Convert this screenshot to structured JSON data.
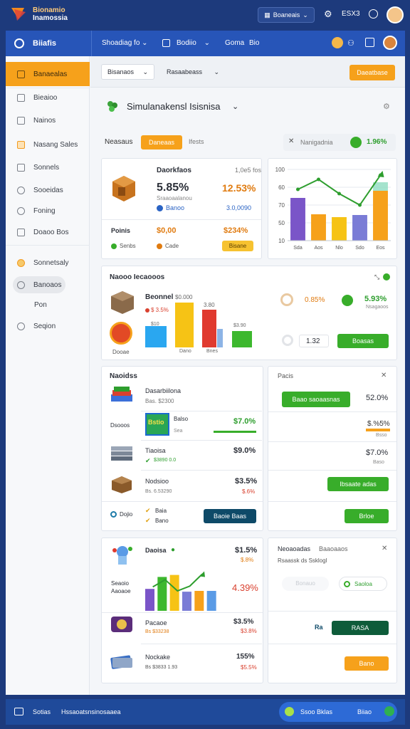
{
  "app": {
    "title_line1": "Bionamio",
    "title_line2": "Inamossia"
  },
  "topbar": {
    "selector_label": "Boaneais",
    "code_label": "ESX3"
  },
  "navbar": {
    "brand": "Biiafis",
    "menu1": "Shoadiag fo",
    "menu2": "Bodiio",
    "menu3": "Goma",
    "menu4": "Bio"
  },
  "sidebar": {
    "items": [
      {
        "label": "Banaealas"
      },
      {
        "label": "Bieaioo"
      },
      {
        "label": "Nainos"
      },
      {
        "label": "Nasang Sales"
      },
      {
        "label": "Sonnels"
      },
      {
        "label": "Sooeidas"
      },
      {
        "label": "Foning"
      },
      {
        "label": "Doaoo Bos"
      },
      {
        "label": "Sonnetsaly"
      },
      {
        "label": "Banoaos"
      },
      {
        "label": "Pon"
      },
      {
        "label": "Seqion"
      }
    ]
  },
  "filters": {
    "dropdown1": "Bisanaos",
    "dropdown2": "Rasaabeass",
    "action": "Daeatbase"
  },
  "page": {
    "title": "Simulanakensl Isisnisa"
  },
  "tabs": {
    "label": "Neasaus",
    "active": "Daneaas",
    "other": "Ifests"
  },
  "search": {
    "placeholder": "Nanigadnia",
    "value": "1.96%"
  },
  "kpi": {
    "heading": "Daorkfaos",
    "heading_right": "1,0e5 fos",
    "main_value": "5.85%",
    "main_change": "12.53%",
    "sub_label": "Sraaoaalanou",
    "sub_link": "Banoo",
    "sub_right": "3.0,0090",
    "row2_label": "Poinis",
    "row2_value": "$0,00",
    "row2_right": "$234%",
    "row3_a": "Senbs",
    "row3_b": "Cade",
    "button": "Bisane"
  },
  "chart1": {
    "yticks": [
      "100",
      "60",
      "70",
      "50",
      "10"
    ],
    "xlabels": [
      "Sda",
      "Aos",
      "Nlo",
      "Sdo",
      "Eos"
    ]
  },
  "chart_data": {
    "type": "bar",
    "categories": [
      "Sda",
      "Aos",
      "Nlo",
      "Sdo",
      "Eos"
    ],
    "values": [
      60,
      37,
      33,
      36,
      70
    ],
    "line": [
      72,
      86,
      66,
      50,
      92
    ],
    "ylim": [
      0,
      100
    ],
    "yticks": [
      "100",
      "60",
      "70",
      "50",
      "10"
    ]
  },
  "inventory": {
    "heading": "Naooo Iecaooos",
    "bar_title": "Beonnel",
    "bar_val1": "$0.000",
    "bar_val2": "3.80",
    "stat1": "$ 3.5%",
    "item2_label": "Dooae",
    "item2_val": "$10",
    "mini_labels": [
      "",
      "Dano",
      "Bnes"
    ],
    "mini_top": "$3.90",
    "right_pct1": "0.85%",
    "right_pct2": "5.93%",
    "right_sub": "Nsagaoos",
    "right_val": "1.32",
    "right_btn": "Boasas"
  },
  "orders": {
    "heading": "Naoidss",
    "rows": [
      {
        "title": "Dasarbiilona",
        "sub": "Bas. $2300",
        "value": ""
      },
      {
        "title": "Balso",
        "sub": "Sea",
        "value": "$7.0%",
        "badge": "Bstio",
        "side": "Dsooos"
      },
      {
        "title": "Tiaoisa",
        "sub": "$3890 0.0",
        "value": "$9.0%"
      },
      {
        "title": "Nodsioo",
        "sub": "Bs. 6.53290",
        "value": "$3.5%",
        "value2": "$.6%"
      }
    ],
    "footer_a": "Dojio",
    "footer_b": "Baia",
    "footer_c": "Bano",
    "footer_btn": "Baoie Baas"
  },
  "side_panel": {
    "heading": "Pacis",
    "btn1": "Baao saoaasnas",
    "v1": "52.0%",
    "v2": "$.%5%",
    "v2b": "Bsso",
    "v3": "$7.0%",
    "v3b": "Baso",
    "btn2": "Ibsaate adas",
    "btn3": "Brloe"
  },
  "products": {
    "top_title": "Daoisa",
    "top_val": "$1.5%",
    "top_sub": "$.8%",
    "chart_label1": "Seaoio",
    "chart_label2": "Aaoaoe",
    "chart_val": "4.39%",
    "mini_bars": [
      55,
      85,
      90,
      48,
      50,
      50
    ],
    "mini_line": [
      60,
      78,
      50,
      62,
      92
    ],
    "rows": [
      {
        "title": "Pacaoe",
        "sub": "Bs $33238",
        "value": "$3.5%",
        "value2": "$3.8%"
      },
      {
        "title": "Nockake",
        "sub": "Bs $3833 1.93",
        "value": "155%",
        "value2": "$5.5%"
      }
    ]
  },
  "settings": {
    "title1": "Neoaoadas",
    "title2": "Baaoaaos",
    "sub": "Rsaassk ds Ssklogl",
    "ghost": "Bonauo",
    "toggle": "Saoloa",
    "num": "Ra",
    "btn1": "RASA",
    "btn2": "Bano"
  },
  "footer": {
    "icon_text": "Sotias",
    "label": "Hssaoatsnsinosaaea",
    "status": "Ssoo Bklas",
    "status2": "Biiao"
  }
}
